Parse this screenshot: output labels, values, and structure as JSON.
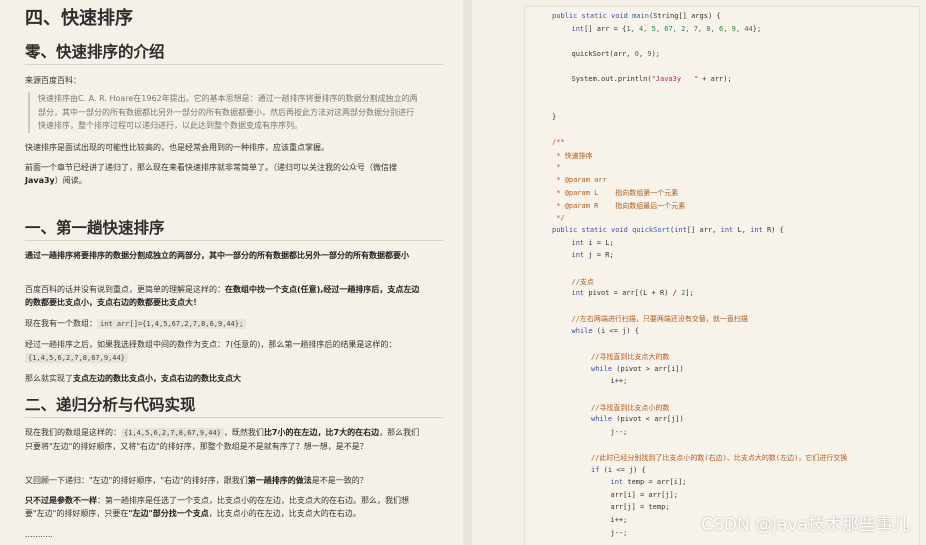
{
  "left": {
    "h_section4": "四、快速排序",
    "h_intro": "零、快速排序的介绍",
    "source": "来源百度百科：",
    "quote": "快速排序由C. A. R. Hoare在1962年提出。它的基本思想是：通过一趟排序将要排序的数据分割成独立的两部分，其中一部分的所有数据都比另外一部分的所有数据都要小，然后再按此方法对这两部分数据分别进行快速排序，整个排序过程可以递归进行，以此达到整个数据变成有序序列。",
    "p1": "快速排序是面试出现的可能性比较高的，也是经常会用到的一种排序，应该重点掌握。",
    "p2a": "前面一个章节已经讲了递归了，那么现在来看快速排序就非常简单了。（递归可以关注我的公众号（微信搜",
    "p2b": "Java3y",
    "p2c": "）阅读。",
    "h_first": "一、第一趟快速排序",
    "p3": "通过一趟排序将要排序的数据分割成独立的两部分，其中一部分的所有数据都比另外一部分的所有数据都要小",
    "p4a": "百度百科的话并没有说到重点，更简单的理解是这样的：",
    "p4b": "在数组中找一个支点(任意),经过一趟排序后，支点左边的数都要比支点小，支点右边的数都要比支点大！",
    "p5a": "现在我有一个数组：",
    "p5code": "int arr[]={1,4,5,67,2,7,8,6,9,44};",
    "p6a": "经过一趟排序之后，如果我选择数组中间的数作为支点：7(任意的)，那么第一趟排序后的结果是这样的：",
    "p6code": "{1,4,5,6,2,7,8,67,9,44}",
    "p7a": "那么就实现了",
    "p7b": "支点左边的数比支点小，支点右边的数比支点大",
    "h_recursion": "二、递归分析与代码实现",
    "p8a": "现在我们的数组是这样的：",
    "p8code": "{1,4,5,6,2,7,8,67,9,44}",
    "p8b": "，既然我们",
    "p8c": "比7小的在左边，比7大的在右边",
    "p8d": "，那么我们只要将\"左边\"的排好顺序，又将\"右边\"的排好序，那整个数组是不是就有序了？想一想，是不是？",
    "p9a": "又回顾一下递归：\"左边\"的排好顺序，\"右边\"的排好序，跟我们",
    "p9b": "第一趟排序的做法",
    "p9c": "是不是一致的？",
    "p10a": "只不过是参数不一样",
    "p10b": "：第一趟排序是任选了一个支点，比支点小的在左边，比支点大的在右边。那么，我们想要\"左边\"的排好顺序，只要在",
    "p10c": "\"左边\"部分找一个支点",
    "p10d": "，比支点小的在左边，比支点大的在右边。",
    "ellipsis": "..........."
  },
  "code": [
    {
      "segs": [
        [
          "kw",
          "public static void "
        ],
        [
          "fn",
          "main"
        ],
        [
          "",
          "(String[] args) {"
        ]
      ],
      "indent": 0
    },
    {
      "segs": [
        [
          "kw",
          "int"
        ],
        [
          "",
          "[] arr = {"
        ],
        [
          "num",
          "1, 4, 5, 67, 2, 7, 8, 6, 9, 44"
        ],
        [
          "",
          "};"
        ]
      ],
      "indent": 1
    },
    {
      "segs": [],
      "indent": 0
    },
    {
      "segs": [
        [
          "",
          "quickSort(arr, "
        ],
        [
          "num",
          "0"
        ],
        [
          "",
          ", "
        ],
        [
          "num",
          "9"
        ],
        [
          "",
          ");"
        ]
      ],
      "indent": 1
    },
    {
      "segs": [],
      "indent": 0
    },
    {
      "segs": [
        [
          "",
          "System.out.println("
        ],
        [
          "str",
          "\"Java3y   \""
        ],
        [
          "",
          " + arr);"
        ]
      ],
      "indent": 1
    },
    {
      "segs": [],
      "indent": 0
    },
    {
      "segs": [],
      "indent": 0
    },
    {
      "segs": [
        [
          "",
          "}"
        ]
      ],
      "indent": 0
    },
    {
      "segs": [],
      "indent": 0
    },
    {
      "segs": [
        [
          "cm",
          "/**"
        ]
      ],
      "indent": 0
    },
    {
      "segs": [
        [
          "cm",
          " * 快速排序"
        ]
      ],
      "indent": 0
    },
    {
      "segs": [
        [
          "cm",
          " *"
        ]
      ],
      "indent": 0
    },
    {
      "segs": [
        [
          "cm",
          " * @param arr"
        ]
      ],
      "indent": 0
    },
    {
      "segs": [
        [
          "cm",
          " * @param L    指向数组第一个元素"
        ]
      ],
      "indent": 0
    },
    {
      "segs": [
        [
          "cm",
          " * @param R    指向数组最后一个元素"
        ]
      ],
      "indent": 0
    },
    {
      "segs": [
        [
          "cm",
          " */"
        ]
      ],
      "indent": 0
    },
    {
      "segs": [
        [
          "kw",
          "public static void "
        ],
        [
          "fn",
          "quickSort"
        ],
        [
          "",
          "("
        ],
        [
          "kw",
          "int"
        ],
        [
          "",
          "[] arr, "
        ],
        [
          "kw",
          "int"
        ],
        [
          "",
          " L, "
        ],
        [
          "kw",
          "int"
        ],
        [
          "",
          " R) {"
        ]
      ],
      "indent": 0
    },
    {
      "segs": [
        [
          "kw",
          "int"
        ],
        [
          "",
          " i = L;"
        ]
      ],
      "indent": 1
    },
    {
      "segs": [
        [
          "kw",
          "int"
        ],
        [
          "",
          " j = R;"
        ]
      ],
      "indent": 1
    },
    {
      "segs": [],
      "indent": 0
    },
    {
      "segs": [
        [
          "cm",
          "//支点"
        ]
      ],
      "indent": 1
    },
    {
      "segs": [
        [
          "kw",
          "int"
        ],
        [
          "",
          " pivot = arr[(L + R) / "
        ],
        [
          "num",
          "2"
        ],
        [
          "",
          "];"
        ]
      ],
      "indent": 1
    },
    {
      "segs": [],
      "indent": 0
    },
    {
      "segs": [
        [
          "cm",
          "//左右两端进行扫描，只要两端还没有交替，就一直扫描"
        ]
      ],
      "indent": 1
    },
    {
      "segs": [
        [
          "kw",
          "while"
        ],
        [
          "",
          " (i <= j) {"
        ]
      ],
      "indent": 1
    },
    {
      "segs": [],
      "indent": 0
    },
    {
      "segs": [
        [
          "cm",
          "//寻找直到比支点大的数"
        ]
      ],
      "indent": 2
    },
    {
      "segs": [
        [
          "kw",
          "while"
        ],
        [
          "",
          " (pivot > arr[i])"
        ]
      ],
      "indent": 2
    },
    {
      "segs": [
        [
          "",
          "i++;"
        ]
      ],
      "indent": 3
    },
    {
      "segs": [],
      "indent": 0
    },
    {
      "segs": [
        [
          "cm",
          "//寻找直到比支点小的数"
        ]
      ],
      "indent": 2
    },
    {
      "segs": [
        [
          "kw",
          "while"
        ],
        [
          "",
          " (pivot < arr[j])"
        ]
      ],
      "indent": 2
    },
    {
      "segs": [
        [
          "",
          "j--;"
        ]
      ],
      "indent": 3
    },
    {
      "segs": [],
      "indent": 0
    },
    {
      "segs": [
        [
          "cm",
          "//此时已经分别找到了比支点小的数(右边)、比支点大的数(左边)，它们进行交换"
        ]
      ],
      "indent": 2
    },
    {
      "segs": [
        [
          "kw",
          "if"
        ],
        [
          "",
          " (i <= j) {"
        ]
      ],
      "indent": 2
    },
    {
      "segs": [
        [
          "kw",
          "int"
        ],
        [
          "",
          " temp = arr[i];"
        ]
      ],
      "indent": 3
    },
    {
      "segs": [
        [
          "",
          "arr[i] = arr[j];"
        ]
      ],
      "indent": 3
    },
    {
      "segs": [
        [
          "",
          "arr[j] = temp;"
        ]
      ],
      "indent": 3
    },
    {
      "segs": [
        [
          "",
          "i++;"
        ]
      ],
      "indent": 3
    },
    {
      "segs": [
        [
          "",
          "j--;"
        ]
      ],
      "indent": 3
    }
  ],
  "watermark": "CSDN @Java技术那些事儿"
}
